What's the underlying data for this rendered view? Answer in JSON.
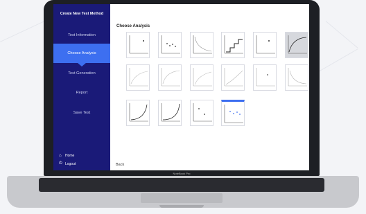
{
  "sidebar": {
    "title": "Create New Test Method",
    "items": [
      {
        "label": "Test Information",
        "active": false
      },
      {
        "label": "Choose Analysis",
        "active": true
      },
      {
        "label": "Test Generation",
        "active": false
      },
      {
        "label": "Report",
        "active": false
      },
      {
        "label": "Save Test",
        "active": false
      }
    ],
    "home_label": "Home",
    "logout_label": "Logout"
  },
  "main": {
    "title": "Choose Analysis",
    "back_label": "Back"
  },
  "laptop": {
    "brand": "NoteBook Pro"
  },
  "colors": {
    "sidebar": "#1a1a78",
    "accent": "#3d6ff0"
  }
}
